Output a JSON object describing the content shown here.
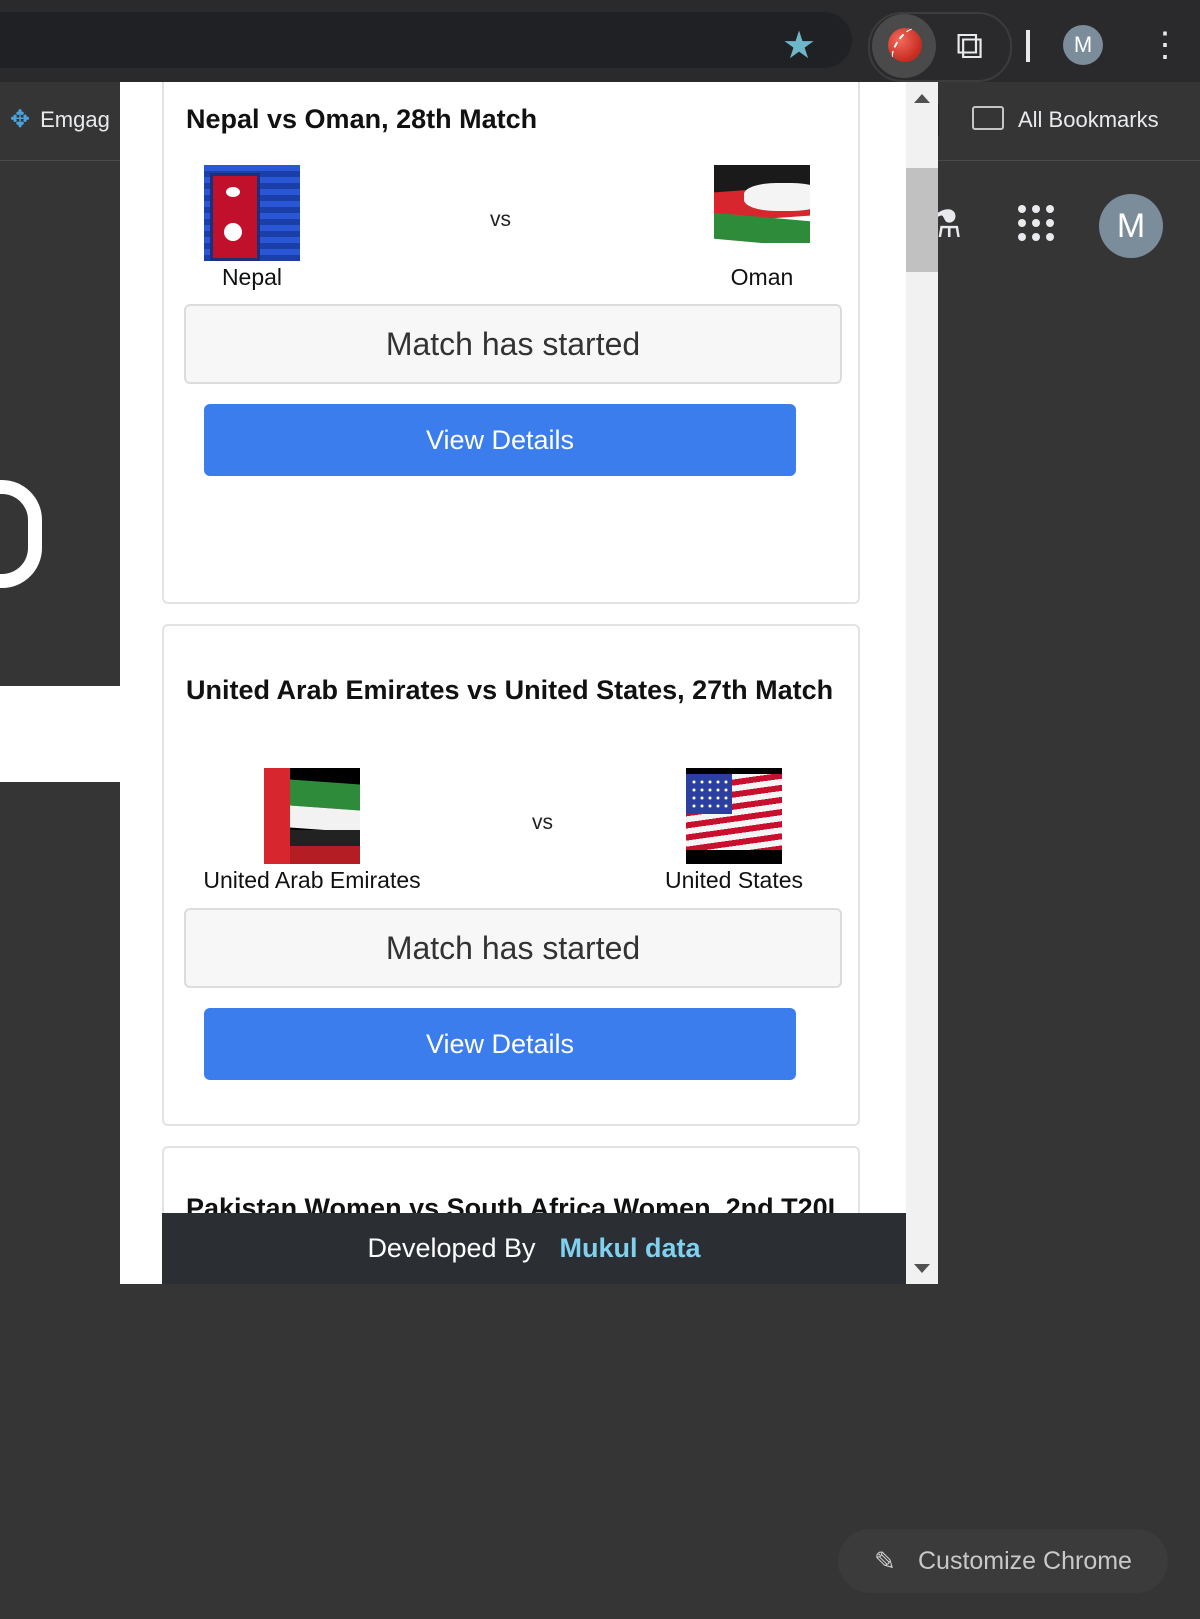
{
  "browser": {
    "bookmarks_bar": {
      "left_item_label": "Emgag",
      "all_bookmarks_label": "All Bookmarks"
    },
    "profile_initial": "M",
    "profile_initial_large": "M",
    "customize_label": "Customize Chrome",
    "icons": [
      "star-icon",
      "cricket-ball-icon",
      "puzzle-icon",
      "kebab-menu-icon",
      "folder-icon",
      "labs-flask-icon",
      "apps-grid-icon",
      "pencil-icon"
    ]
  },
  "popup": {
    "matches": [
      {
        "title": "Nepal vs Oman, 28th Match",
        "team1": "Nepal",
        "team2": "Oman",
        "vs": "vs",
        "status": "Match has started",
        "button": "View Details"
      },
      {
        "title": "United Arab Emirates vs United States, 27th Match",
        "team1": "United Arab Emirates",
        "team2": "United States",
        "vs": "vs",
        "status": "Match has started",
        "button": "View Details"
      },
      {
        "title": "Pakistan Women vs South Africa Women, 2nd T20I"
      }
    ],
    "footer": {
      "prefix": "Developed By",
      "author": "Mukul data"
    }
  },
  "colors": {
    "accent_blue": "#3b7ded",
    "footer_bg": "#2b2f34",
    "footer_author": "#7fd1ef",
    "chrome_dark": "#353535"
  }
}
